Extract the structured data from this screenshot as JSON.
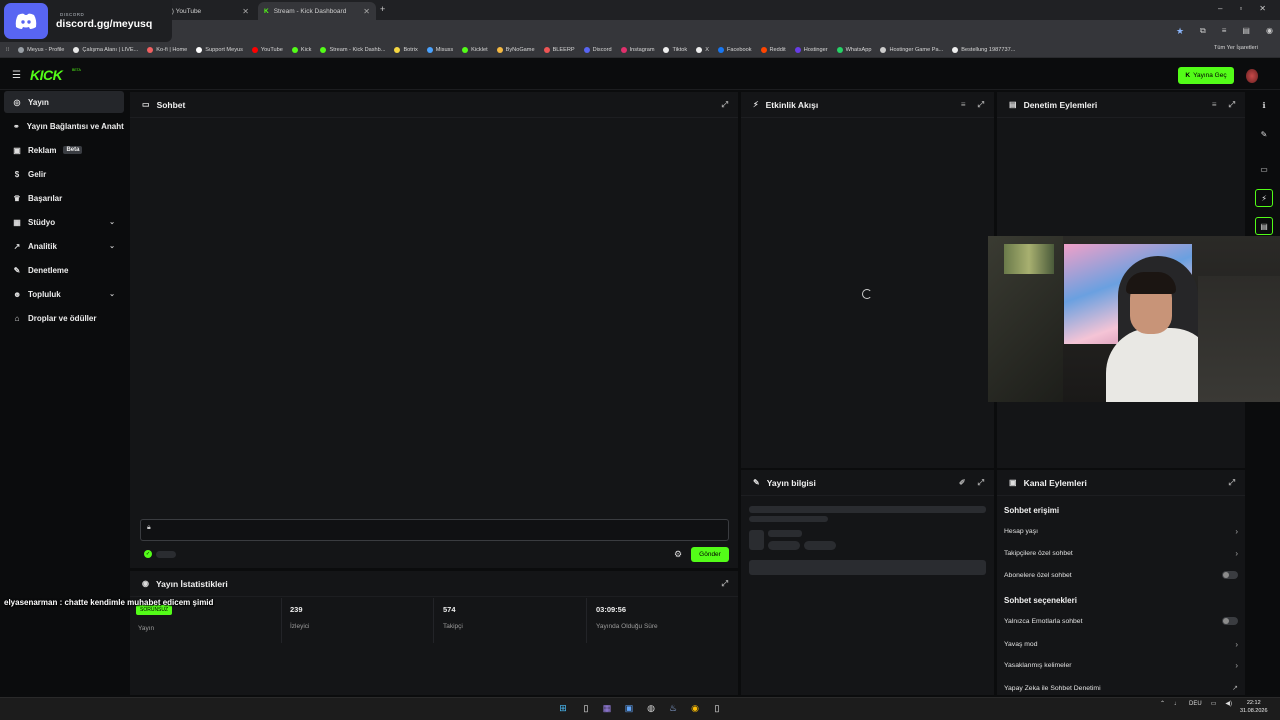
{
  "discord": {
    "url": "discord.gg/meyusq",
    "sub": "DISCORD"
  },
  "tabs": [
    {
      "title": "(1) YouTube"
    },
    {
      "title": "Stream - Kick Dashboard"
    }
  ],
  "new_tab": "+",
  "bookmarks": [
    "Meyus - Profile",
    "Çalışma Alanı | LIVE...",
    "Ko-fi | Home",
    "Support Meyus",
    "YouTube",
    "Kick",
    "Stream - Kick Dashb...",
    "Botrix",
    "Misuss",
    "Kicklet",
    "ByNoGame",
    "BLEERP",
    "Discord",
    "Instagram",
    "Tiktok",
    "X",
    "Facebook",
    "Reddit",
    "Hostinger",
    "WhatsApp",
    "Hostinger Game Pa...",
    "Bestellung 1987737..."
  ],
  "all_bookmarks": "Tüm Yer İşaretleri",
  "header": {
    "logo": "KICK",
    "logo_sup": "BETA",
    "go_live": "Yayına Geç"
  },
  "sidebar": {
    "items": [
      {
        "label": "Yayın"
      },
      {
        "label": "Yayın Bağlantısı ve Anahtar"
      },
      {
        "label": "Reklam",
        "badge": "Beta"
      },
      {
        "label": "Gelir"
      },
      {
        "label": "Başarılar"
      },
      {
        "label": "Stüdyo"
      },
      {
        "label": "Analitik"
      },
      {
        "label": "Denetleme"
      },
      {
        "label": "Topluluk"
      },
      {
        "label": "Droplar ve ödüller"
      }
    ]
  },
  "chat": {
    "title": "Sohbet",
    "send": "Gönder"
  },
  "stats": {
    "title": "Yayın İstatistikleri",
    "status_badge": "SORUNSUZ",
    "cells": [
      {
        "value": "",
        "label": "Yayın"
      },
      {
        "value": "239",
        "label": "İzleyici"
      },
      {
        "value": "574",
        "label": "Takipçi"
      },
      {
        "value": "03:09:56",
        "label": "Yayında Olduğu Süre"
      }
    ]
  },
  "overlay_message": "elyasenarman : chatte kendimle muhabet edicem şimid",
  "activity": {
    "title": "Etkinlik Akışı"
  },
  "mod_actions": {
    "title": "Denetim Eylemleri"
  },
  "stream_info": {
    "title": "Yayın bilgisi"
  },
  "channel": {
    "title": "Kanal Eylemleri",
    "section1": "Sohbet erişimi",
    "rows1": [
      {
        "label": "Hesap yaşı",
        "type": "chevron"
      },
      {
        "label": "Takipçilere özel sohbet",
        "type": "chevron"
      },
      {
        "label": "Abonelere özel sohbet",
        "type": "toggle"
      }
    ],
    "section2": "Sohbet seçenekleri",
    "rows2": [
      {
        "label": "Yalnızca Emotlarla sohbet",
        "type": "toggle"
      },
      {
        "label": "Yavaş mod",
        "type": "chevron"
      },
      {
        "label": "Yasaklanmış kelimeler",
        "type": "chevron"
      },
      {
        "label": "Yapay Zeka ile Sohbet Denetimi",
        "type": "external"
      }
    ]
  },
  "tray": {
    "lang": "DEU",
    "time": "22:12",
    "date": "31.08.2026"
  },
  "colors": {
    "accent": "#53fc18",
    "discord": "#5865f2"
  }
}
